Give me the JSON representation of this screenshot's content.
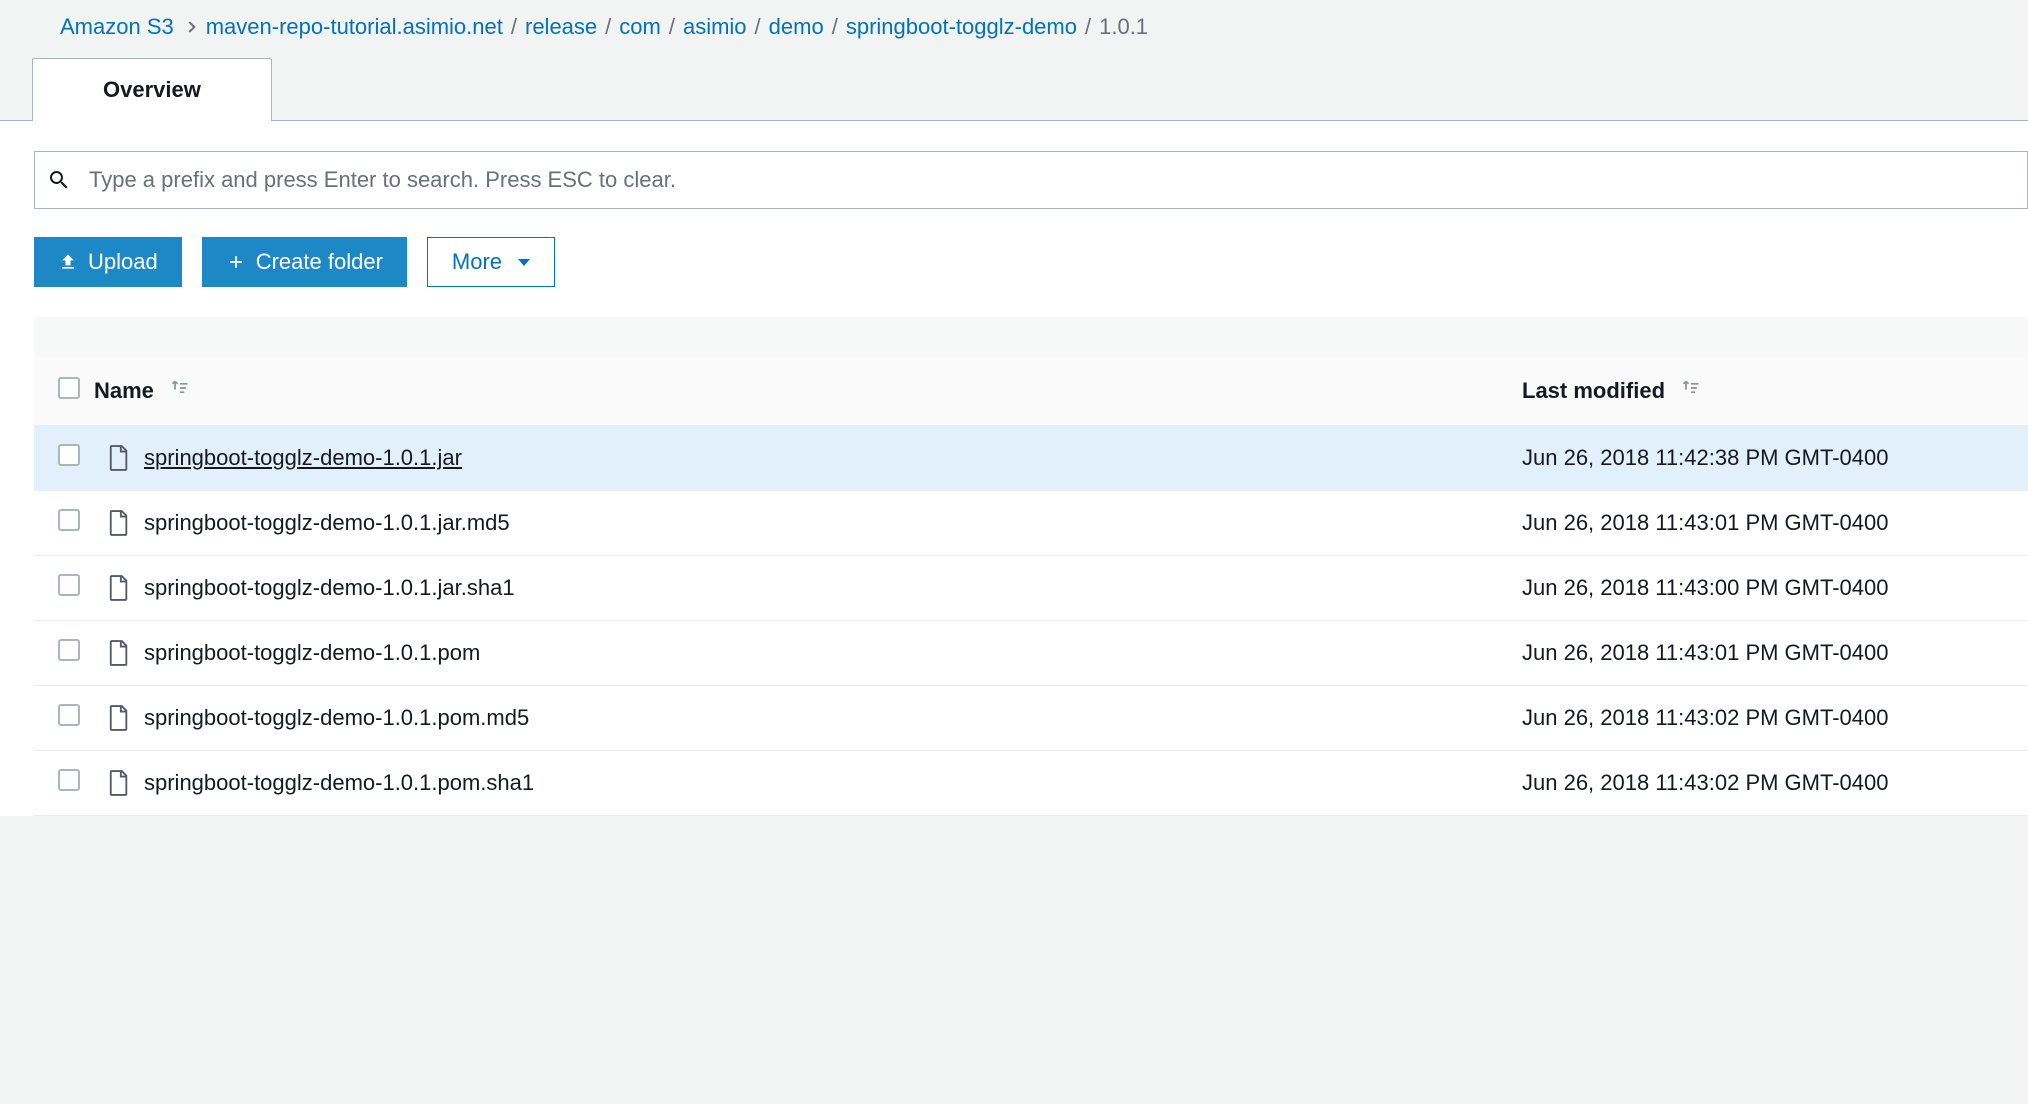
{
  "breadcrumb": {
    "root": "Amazon S3",
    "parts": [
      "maven-repo-tutorial.asimio.net",
      "release",
      "com",
      "asimio",
      "demo",
      "springboot-togglz-demo"
    ],
    "current": "1.0.1"
  },
  "tabs": {
    "overview": "Overview"
  },
  "search": {
    "placeholder": "Type a prefix and press Enter to search. Press ESC to clear."
  },
  "toolbar": {
    "upload_label": "Upload",
    "create_folder_label": "Create folder",
    "more_label": "More"
  },
  "table": {
    "headers": {
      "name": "Name",
      "last_modified": "Last modified"
    },
    "rows": [
      {
        "name": "springboot-togglz-demo-1.0.1.jar",
        "date": "Jun 26, 2018 11:42:38 PM GMT-0400",
        "hot": true
      },
      {
        "name": "springboot-togglz-demo-1.0.1.jar.md5",
        "date": "Jun 26, 2018 11:43:01 PM GMT-0400",
        "hot": false
      },
      {
        "name": "springboot-togglz-demo-1.0.1.jar.sha1",
        "date": "Jun 26, 2018 11:43:00 PM GMT-0400",
        "hot": false
      },
      {
        "name": "springboot-togglz-demo-1.0.1.pom",
        "date": "Jun 26, 2018 11:43:01 PM GMT-0400",
        "hot": false
      },
      {
        "name": "springboot-togglz-demo-1.0.1.pom.md5",
        "date": "Jun 26, 2018 11:43:02 PM GMT-0400",
        "hot": false
      },
      {
        "name": "springboot-togglz-demo-1.0.1.pom.sha1",
        "date": "Jun 26, 2018 11:43:02 PM GMT-0400",
        "hot": false
      }
    ]
  }
}
